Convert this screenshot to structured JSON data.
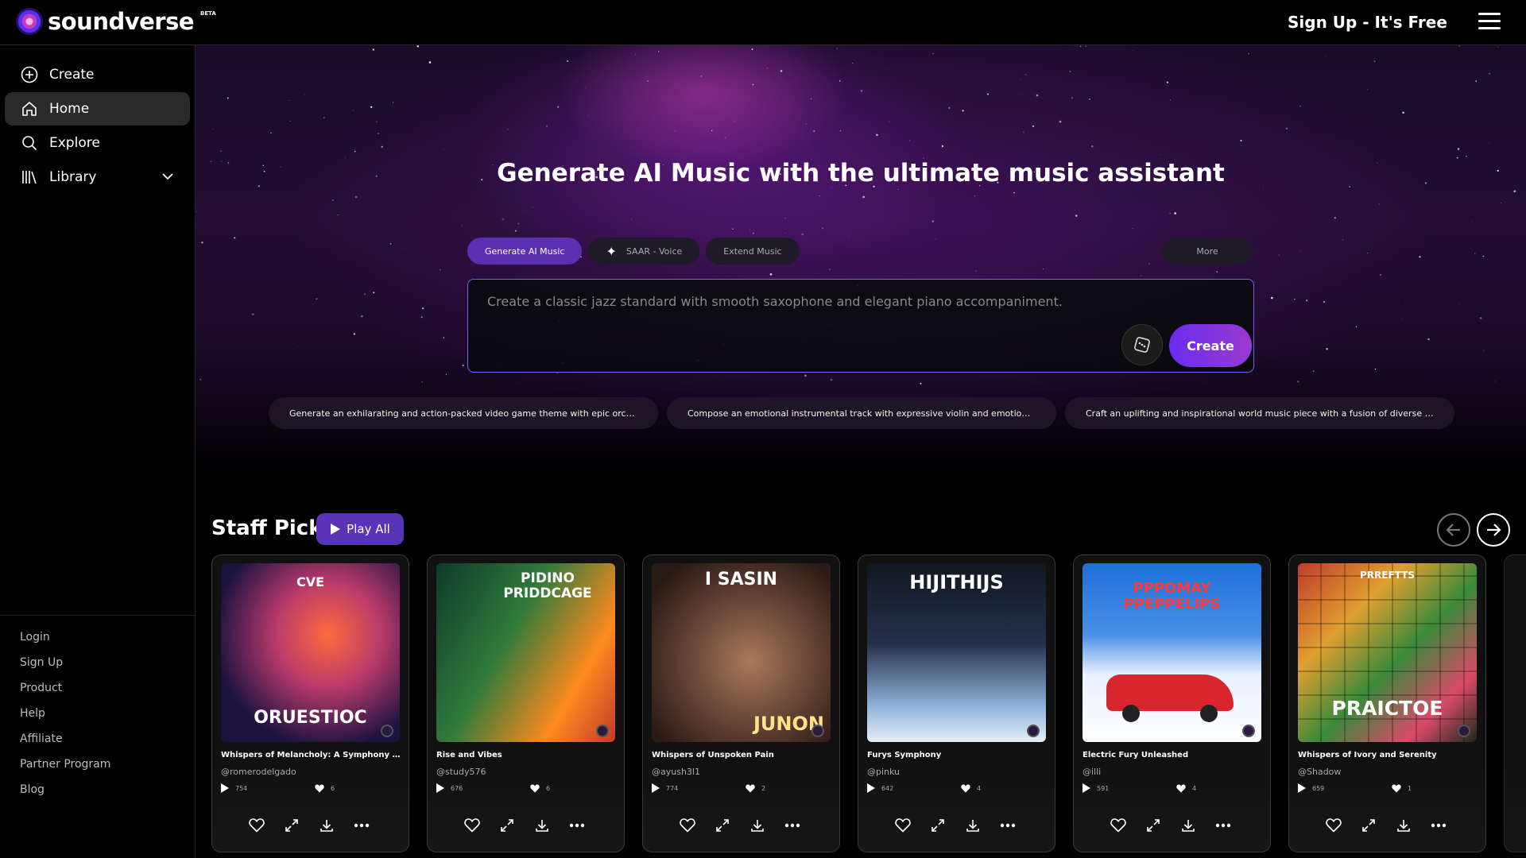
{
  "brand": {
    "name": "soundverse",
    "badge": "BETA"
  },
  "topbar": {
    "signup": "Sign Up - It's Free",
    "menu_icon": "hamburger-icon"
  },
  "sidebar": {
    "items": [
      {
        "label": "Create",
        "icon": "plus-circle-icon"
      },
      {
        "label": "Home",
        "icon": "home-icon",
        "active": true
      },
      {
        "label": "Explore",
        "icon": "search-icon"
      },
      {
        "label": "Library",
        "icon": "library-icon"
      }
    ],
    "footer_links": [
      "Login",
      "Sign Up",
      "Product",
      "Help",
      "Affiliate",
      "Partner Program",
      "Blog"
    ],
    "social": [
      "instagram-icon",
      "linkedin-icon",
      "twitter-icon",
      "youtube-icon"
    ]
  },
  "hero": {
    "title": "Generate AI Music with the ultimate music assistant",
    "tabs": [
      "Generate AI Music",
      "SAAR - Voice",
      "Extend Music"
    ],
    "more": "More",
    "prompt_placeholder": "Create a classic jazz standard with smooth saxophone and elegant piano accompaniment.",
    "create_label": "Create",
    "suggestions": [
      "Generate an exhilarating and action-packed video game theme with epic orchestr...",
      "Compose an emotional instrumental track with expressive violin and emotional pia...",
      "Craft an uplifting and inspirational world music piece with a fusion of diverse cultur..."
    ]
  },
  "staff_picks": {
    "title": "Staff Picks",
    "play_all": "Play All",
    "tracks": [
      {
        "title": "Whispers of Melancholy: A Symphony Unvei...",
        "author": "@romerodelgado",
        "plays": "754",
        "likes": "6",
        "art_top": "CVE",
        "art_bottom": "ORUESTIOC",
        "colors": [
          "#1b1240",
          "#ff6a3d"
        ]
      },
      {
        "title": "Rise and Vibes",
        "author": "@study576",
        "plays": "676",
        "likes": "6",
        "art_top": "PIDINO PRIDDCAGE",
        "art_bottom": "",
        "colors": [
          "#0e3a2a",
          "#ff8a1f"
        ]
      },
      {
        "title": "Whispers of Unspoken Pain",
        "author": "@ayush3l1",
        "plays": "774",
        "likes": "2",
        "art_top": "I SASIN",
        "art_bottom": "JUNON",
        "colors": [
          "#6e4a3a",
          "#2a1a14"
        ]
      },
      {
        "title": "Furys Symphony",
        "author": "@pinku",
        "plays": "642",
        "likes": "4",
        "art_top": "HIJITHIJS",
        "art_bottom": "",
        "colors": [
          "#24304a",
          "#8fb3d9"
        ]
      },
      {
        "title": "Electric Fury Unleashed",
        "author": "@illi",
        "plays": "591",
        "likes": "4",
        "art_top": "PPPOMAY PPEPPELIPS",
        "art_bottom": "",
        "colors": [
          "#1d6fd8",
          "#e8f0ff"
        ]
      },
      {
        "title": "Whispers of Ivory and Serenity",
        "author": "@Shadow",
        "plays": "659",
        "likes": "1",
        "art_top": "PRREFTTS",
        "art_bottom": "PRAICTOE",
        "colors": [
          "#1a2a1a",
          "#c23a2a"
        ]
      }
    ]
  }
}
